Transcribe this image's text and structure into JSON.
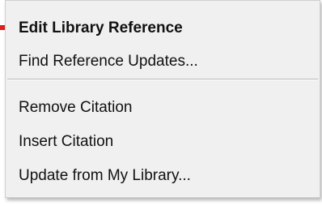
{
  "context_menu": {
    "items": [
      {
        "label": "Edit Library Reference",
        "default": true
      },
      {
        "label": "Find Reference Updates..."
      },
      {
        "label": "Remove Citation"
      },
      {
        "label": "Insert Citation"
      },
      {
        "label": "Update from My Library..."
      }
    ]
  },
  "pointer": {
    "icon": "red-arrow-icon",
    "color": "#e0201a"
  }
}
